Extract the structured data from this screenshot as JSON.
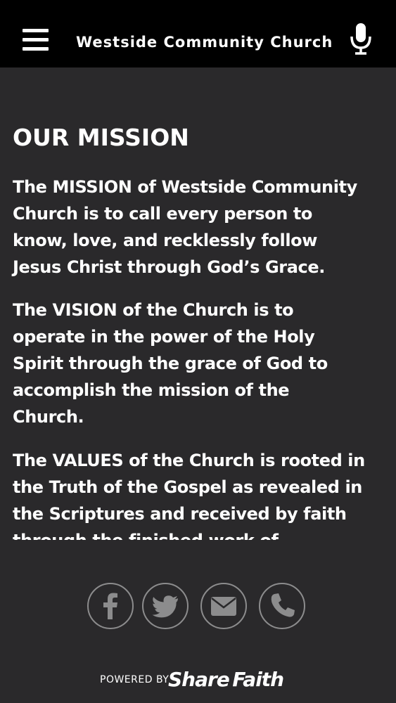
{
  "header": {
    "title": "Westside Community Church",
    "menu_icon": "hamburger-menu-icon",
    "voice_icon": "microphone-icon"
  },
  "content": {
    "heading": "OUR MISSION",
    "paragraphs": [
      {
        "lines": [
          "The MISSION of Westside Community",
          "Church is to call every person to",
          "know, love, and recklessly follow",
          "Jesus Christ through God’s Grace."
        ]
      },
      {
        "lines": [
          "The VISION of the Church is to",
          "operate in the power of the Holy",
          "Spirit through the grace of God to",
          "accomplish the mission of the",
          "Church."
        ]
      },
      {
        "lines": [
          "The VALUES of the Church is rooted in",
          "the Truth of the Gospel as revealed in",
          "the Scriptures and received by faith",
          "through the finished work of"
        ]
      }
    ]
  },
  "social": {
    "icons": [
      "facebook-icon",
      "twitter-icon",
      "email-icon",
      "phone-icon"
    ],
    "ring_color": "#8c8c8d"
  },
  "footer": {
    "powered_label": "POWERED BY",
    "brand": "Share Faith"
  },
  "colors": {
    "header_bg": "#000000",
    "page_bg": "#2a292b",
    "text": "#ffffff"
  }
}
